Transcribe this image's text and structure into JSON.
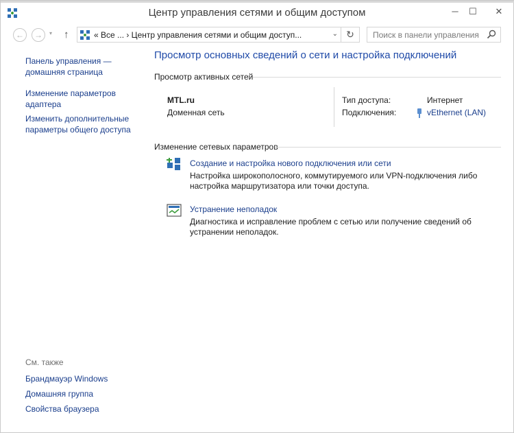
{
  "window": {
    "title": "Центр управления сетями и общим доступом",
    "minimize_glyph": "─",
    "maximize_glyph": "☐",
    "close_glyph": "✕"
  },
  "navbar": {
    "back_glyph": "←",
    "forward_glyph": "→",
    "history_glyph": "▾",
    "up_glyph": "↑",
    "address_text": "«  Все ...  ›  Центр управления сетями и общим доступ...",
    "address_dropdown_glyph": "⌄",
    "refresh_glyph": "↻",
    "search_placeholder": "Поиск в панели управления"
  },
  "sidebar": {
    "items": [
      {
        "label": "Панель управления — домашняя страница"
      },
      {
        "label": "Изменение параметров адаптера"
      },
      {
        "label": "Изменить дополнительные параметры общего доступа"
      }
    ],
    "see_also_label": "См. также",
    "see_also": [
      {
        "label": "Брандмауэр Windows"
      },
      {
        "label": "Домашняя группа"
      },
      {
        "label": "Свойства браузера"
      }
    ]
  },
  "main": {
    "title": "Просмотр основных сведений о сети и настройка подключений",
    "active_networks_heading": "Просмотр активных сетей",
    "network": {
      "name": "MTL.ru",
      "type": "Доменная сеть",
      "access_type_label": "Тип доступа:",
      "access_type_value": "Интернет",
      "connections_label": "Подключения:",
      "connections_value": "vEthernet (LAN)"
    },
    "change_settings_heading": "Изменение сетевых параметров",
    "tasks": [
      {
        "link": "Создание и настройка нового подключения или сети",
        "description": "Настройка широкополосного, коммутируемого или VPN-подключения либо настройка маршрутизатора или точки доступа."
      },
      {
        "link": "Устранение неполадок",
        "description": "Диагностика и исправление проблем с сетью или получение сведений об устранении неполадок."
      }
    ]
  },
  "colors": {
    "link": "#1a3e8c",
    "title_blue": "#1f4aa8"
  }
}
